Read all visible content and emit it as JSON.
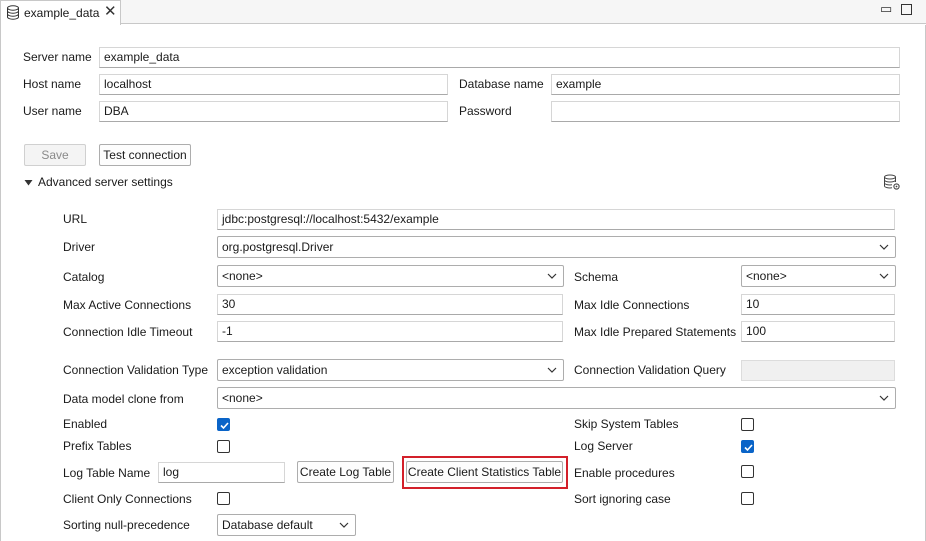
{
  "tab": {
    "label": "example_data",
    "icon": "database-icon",
    "close": "✕"
  },
  "window": {
    "minimize": "▭",
    "maximize": "maximize-icon"
  },
  "server": {
    "server_name_label": "Server name",
    "server_name_value": "example_data",
    "host_name_label": "Host name",
    "host_name_value": "localhost",
    "database_name_label": "Database name",
    "database_name_value": "example",
    "user_name_label": "User name",
    "user_name_value": "DBA",
    "password_label": "Password",
    "password_value": ""
  },
  "actions": {
    "save_label": "Save",
    "test_connection_label": "Test connection"
  },
  "advanced": {
    "toggle_label": "Advanced server settings",
    "url_label": "URL",
    "url_value": "jdbc:postgresql://localhost:5432/example",
    "driver_label": "Driver",
    "driver_value": "org.postgresql.Driver",
    "catalog_label": "Catalog",
    "catalog_value": "<none>",
    "schema_label": "Schema",
    "schema_value": "<none>",
    "max_active_label": "Max Active Connections",
    "max_active_value": "30",
    "max_idle_label": "Max Idle Connections",
    "max_idle_value": "10",
    "idle_timeout_label": "Connection Idle Timeout",
    "idle_timeout_value": "-1",
    "max_idle_prepared_label": "Max Idle Prepared Statements",
    "max_idle_prepared_value": "100",
    "validation_type_label": "Connection Validation Type",
    "validation_type_value": "exception validation",
    "validation_query_label": "Connection Validation Query",
    "validation_query_value": "",
    "clone_from_label": "Data model clone from",
    "clone_from_value": "<none>",
    "enabled_label": "Enabled",
    "enabled_checked": true,
    "skip_system_label": "Skip System Tables",
    "skip_system_checked": false,
    "prefix_tables_label": "Prefix Tables",
    "prefix_tables_checked": false,
    "log_server_label": "Log Server",
    "log_server_checked": true,
    "log_table_label": "Log Table Name",
    "log_table_value": "log",
    "create_log_table_label": "Create Log Table",
    "create_client_stats_label": "Create Client Statistics Table",
    "enable_procedures_label": "Enable procedures",
    "enable_procedures_checked": false,
    "client_only_label": "Client Only Connections",
    "client_only_checked": false,
    "sort_ignoring_case_label": "Sort ignoring case",
    "sort_ignoring_case_checked": false,
    "null_precedence_label": "Sorting null-precedence",
    "null_precedence_value": "Database default"
  },
  "colors": {
    "checkbox_on": "#0a64c8",
    "highlight": "#d3202a"
  }
}
